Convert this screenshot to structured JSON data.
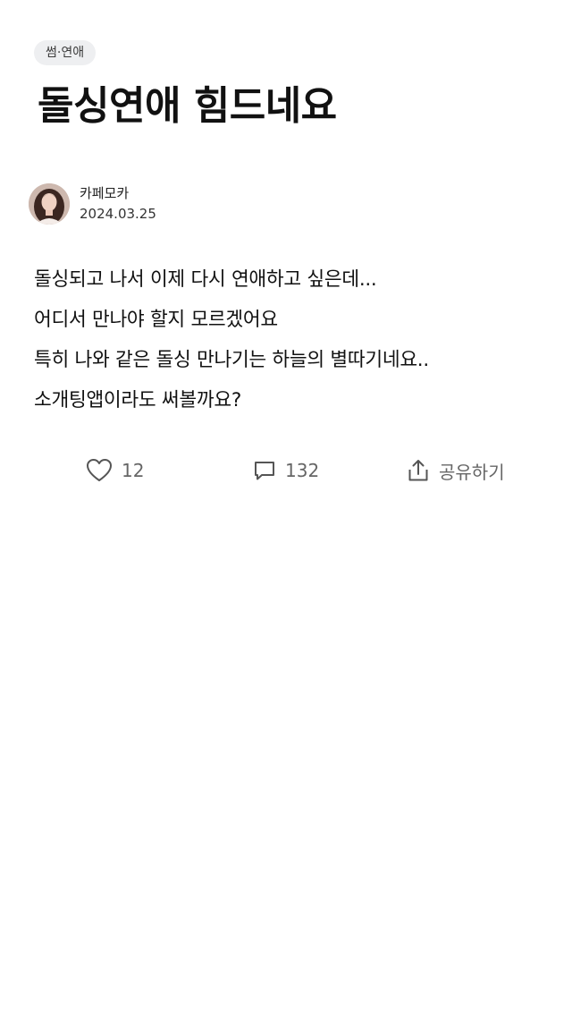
{
  "post": {
    "category": "썸·연애",
    "title": "돌싱연애 힘드네요",
    "author": {
      "name": "카페모카",
      "date": "2024.03.25",
      "avatar_icon": "profile-photo"
    },
    "body_lines": [
      "돌싱되고 나서 이제 다시 연애하고 싶은데...",
      "어디서 만나야 할지 모르겠어요",
      "특히 나와 같은 돌싱 만나기는 하늘의 별따기네요..",
      "소개팅앱이라도 써볼까요?"
    ]
  },
  "actions": {
    "like": {
      "icon": "heart-icon",
      "count": "12"
    },
    "comment": {
      "icon": "comment-icon",
      "count": "132"
    },
    "share": {
      "icon": "share-icon",
      "label": "공유하기"
    }
  },
  "colors": {
    "chip_bg": "#eeeff1",
    "text_primary": "#111111",
    "text_secondary": "#666666"
  }
}
